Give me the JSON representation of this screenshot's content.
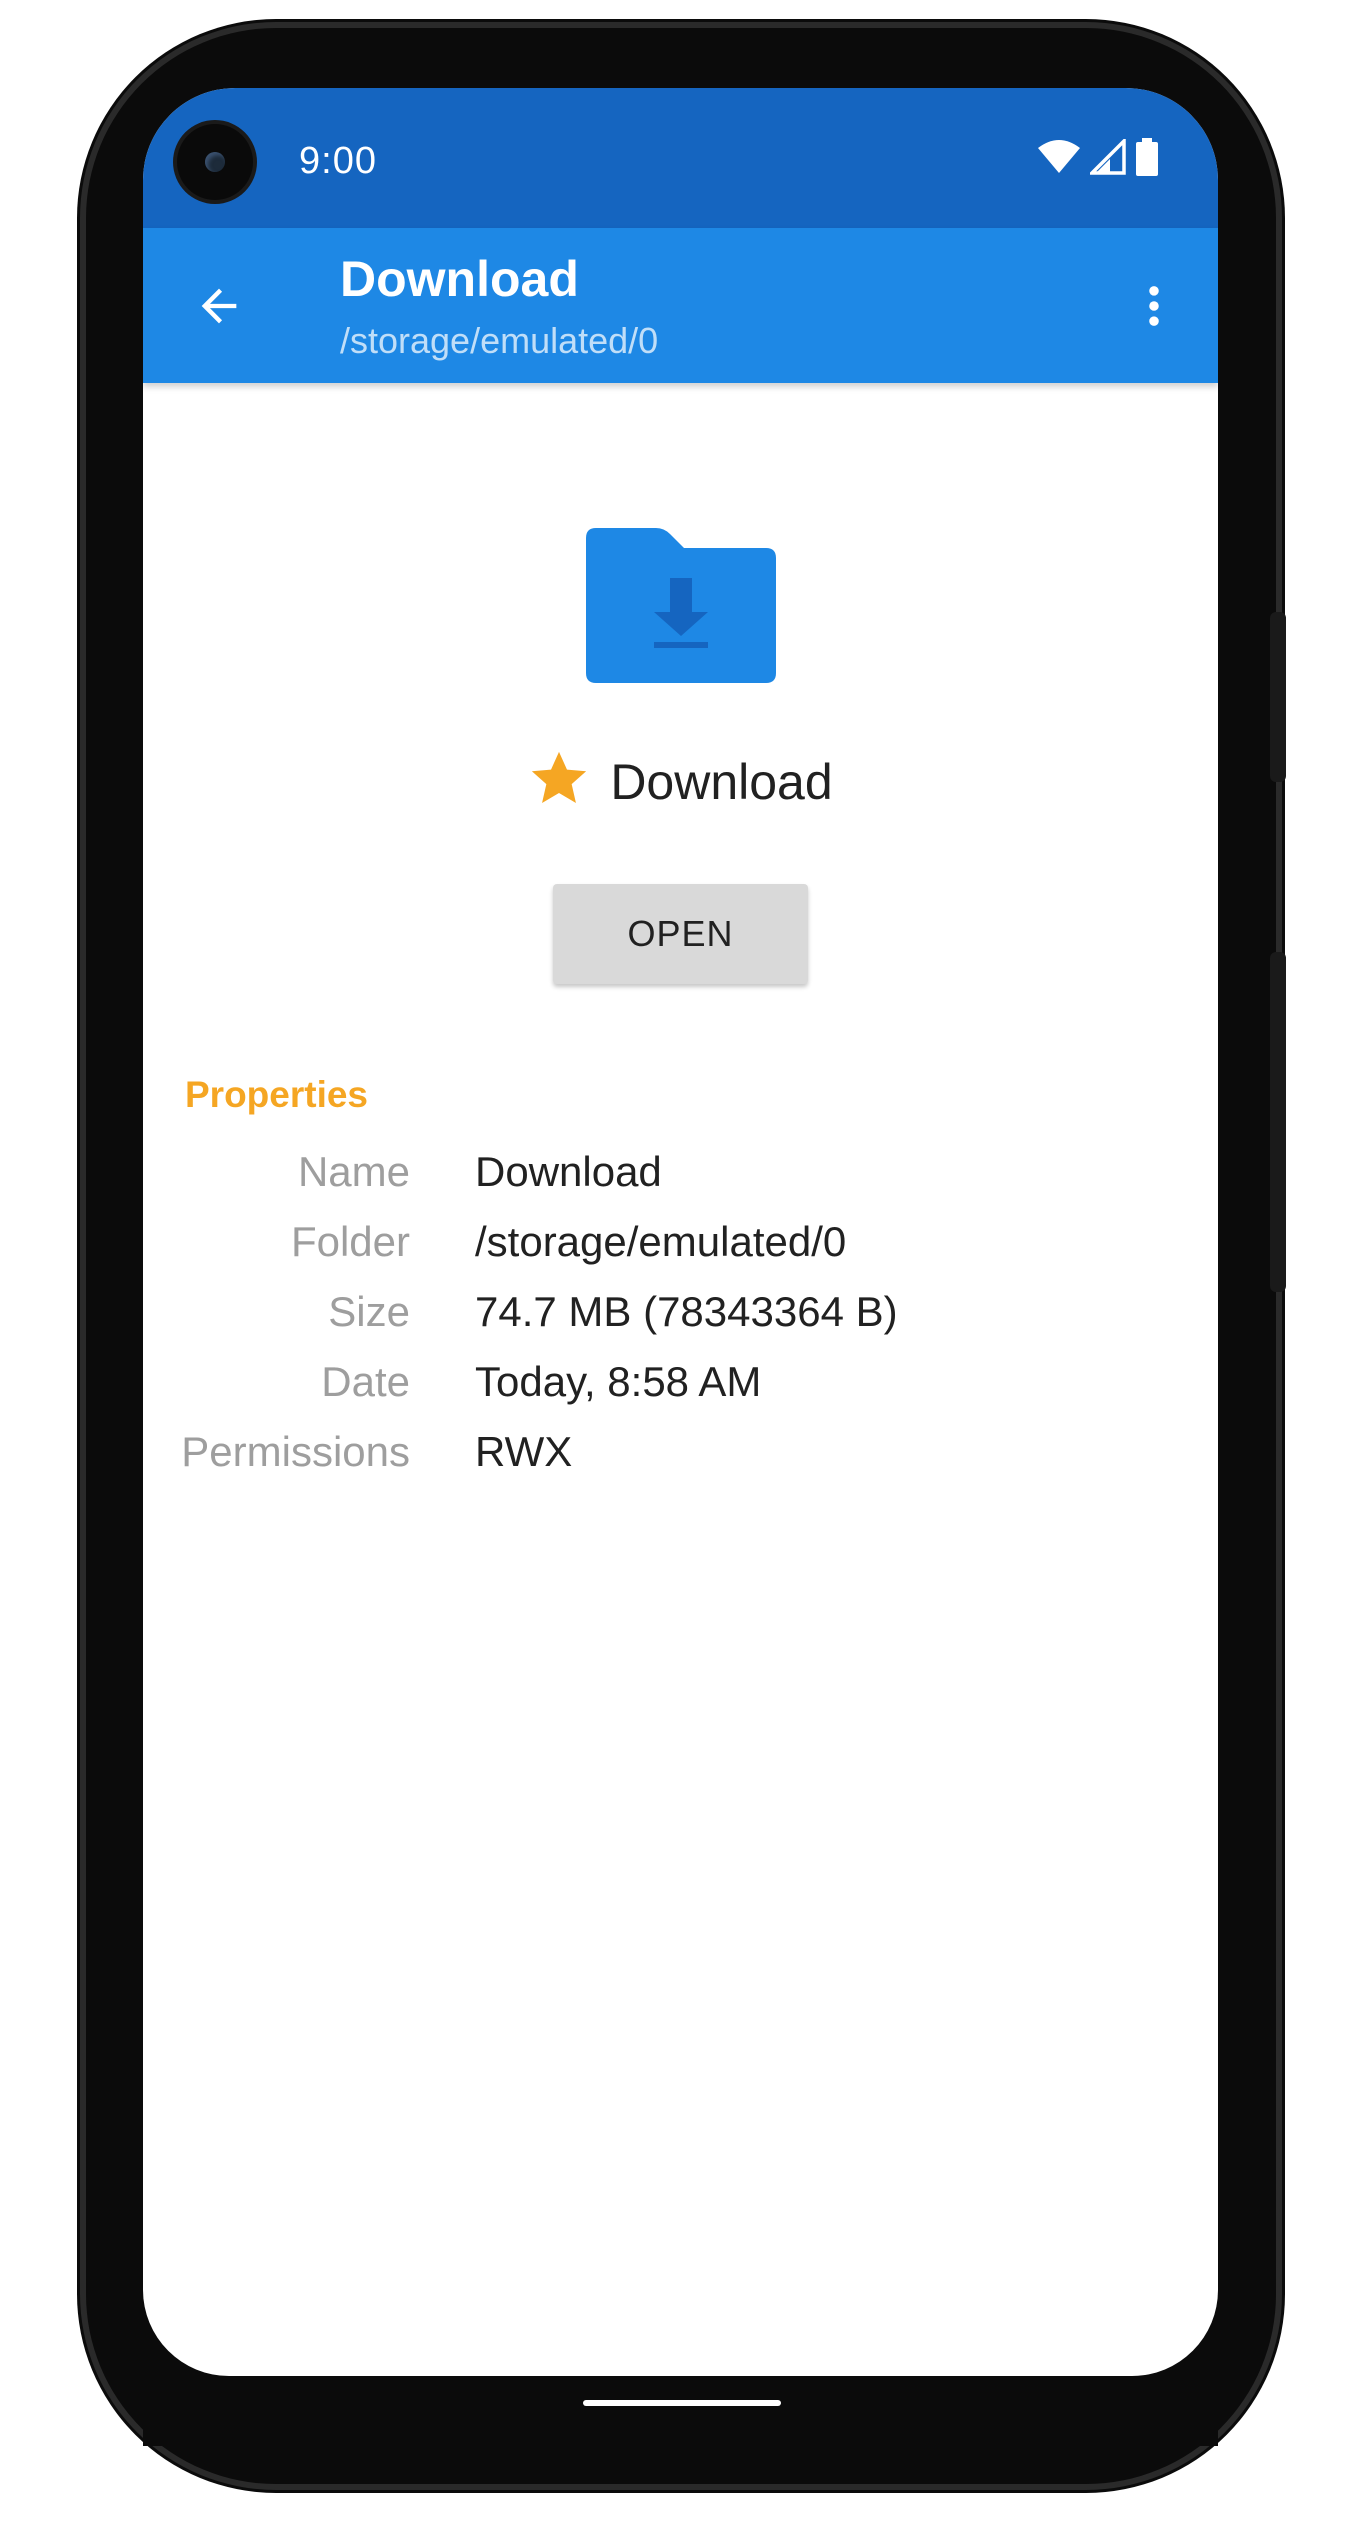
{
  "status_bar": {
    "time": "9:00",
    "icons": [
      "wifi-icon",
      "signal-icon",
      "battery-icon"
    ]
  },
  "app_bar": {
    "title": "Download",
    "subtitle": "/storage/emulated/0",
    "back_icon": "arrow-back-icon",
    "menu_icon": "more-vert-icon"
  },
  "folder": {
    "icon": "folder-download-icon",
    "favorite_icon": "star-icon",
    "name": "Download",
    "open_label": "OPEN"
  },
  "properties": {
    "title": "Properties",
    "rows": [
      {
        "label": "Name",
        "value": "Download"
      },
      {
        "label": "Folder",
        "value": "/storage/emulated/0"
      },
      {
        "label": "Size",
        "value": "74.7 MB (78343364 B)"
      },
      {
        "label": "Date",
        "value": "Today, 8:58 AM"
      },
      {
        "label": "Permissions",
        "value": "RWX"
      }
    ]
  },
  "colors": {
    "status_bar": "#1565c0",
    "app_bar": "#1e88e5",
    "accent": "#f5a623",
    "folder": "#1e88e5"
  }
}
